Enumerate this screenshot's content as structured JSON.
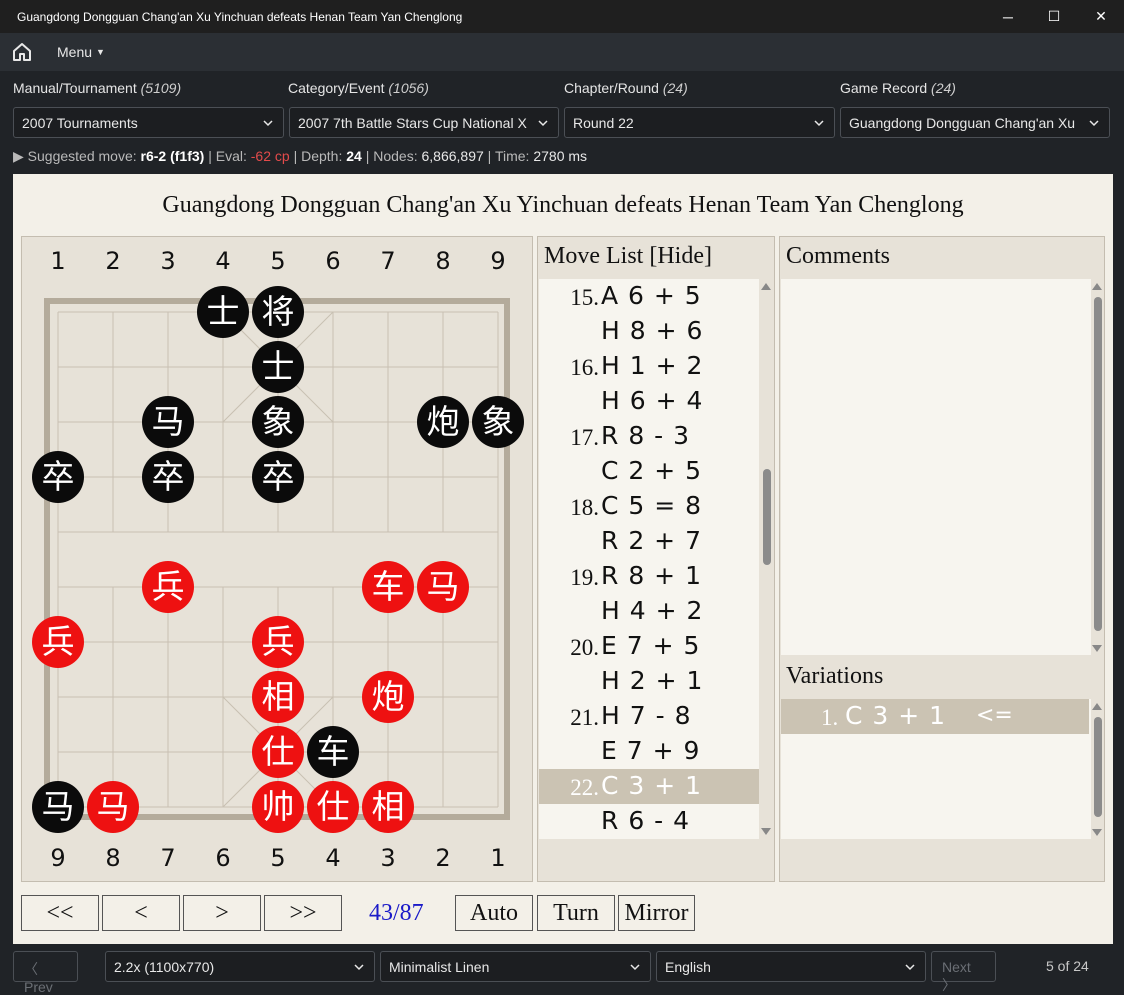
{
  "window": {
    "title": "Guangdong Dongguan Chang'an Xu Yinchuan defeats Henan Team Yan Chenglong",
    "minimize": "─",
    "maximize": "☐",
    "close": "✕"
  },
  "menubar": {
    "home_icon": "home-icon",
    "menu_label": "Menu"
  },
  "selectors": [
    {
      "label": "Manual/Tournament",
      "count": "(5109)",
      "value": "2007 Tournaments"
    },
    {
      "label": "Category/Event",
      "count": "(1056)",
      "value": "2007 7th Battle Stars Cup National X"
    },
    {
      "label": "Chapter/Round",
      "count": "(24)",
      "value": "Round 22"
    },
    {
      "label": "Game Record",
      "count": "(24)",
      "value": "Guangdong Dongguan Chang'an Xu"
    }
  ],
  "engine": {
    "prefix": "▶  Suggested move: ",
    "move": "r6-2",
    "move_code": "(f1f3)",
    "eval_label": "Eval:",
    "eval_value": "-62 cp",
    "depth_label": "Depth:",
    "depth_value": "24",
    "nodes_label": "Nodes:",
    "nodes_value": "6,866,897",
    "time_label": "Time:",
    "time_value": "2780 ms"
  },
  "game_title": "Guangdong Dongguan Chang'an Xu Yinchuan defeats Henan Team Yan Chenglong",
  "board": {
    "top_files": [
      "1",
      "2",
      "3",
      "4",
      "5",
      "6",
      "7",
      "8",
      "9"
    ],
    "bottom_files": [
      "9",
      "8",
      "7",
      "6",
      "5",
      "4",
      "3",
      "2",
      "1"
    ],
    "pieces": [
      {
        "char": "士",
        "side": "black",
        "file": 3,
        "rank": 0
      },
      {
        "char": "将",
        "side": "black",
        "file": 4,
        "rank": 0
      },
      {
        "char": "士",
        "side": "black",
        "file": 4,
        "rank": 1
      },
      {
        "char": "马",
        "side": "black",
        "file": 2,
        "rank": 2
      },
      {
        "char": "象",
        "side": "black",
        "file": 4,
        "rank": 2
      },
      {
        "char": "炮",
        "side": "black",
        "file": 7,
        "rank": 2
      },
      {
        "char": "象",
        "side": "black",
        "file": 8,
        "rank": 2
      },
      {
        "char": "卒",
        "side": "black",
        "file": 0,
        "rank": 3
      },
      {
        "char": "卒",
        "side": "black",
        "file": 2,
        "rank": 3
      },
      {
        "char": "卒",
        "side": "black",
        "file": 4,
        "rank": 3
      },
      {
        "char": "兵",
        "side": "red",
        "file": 2,
        "rank": 5
      },
      {
        "char": "车",
        "side": "red",
        "file": 6,
        "rank": 5
      },
      {
        "char": "马",
        "side": "red",
        "file": 7,
        "rank": 5
      },
      {
        "char": "兵",
        "side": "red",
        "file": 0,
        "rank": 6
      },
      {
        "char": "兵",
        "side": "red",
        "file": 4,
        "rank": 6
      },
      {
        "char": "相",
        "side": "red",
        "file": 4,
        "rank": 7
      },
      {
        "char": "炮",
        "side": "red",
        "file": 6,
        "rank": 7
      },
      {
        "char": "仕",
        "side": "red",
        "file": 4,
        "rank": 8
      },
      {
        "char": "车",
        "side": "black",
        "file": 5,
        "rank": 8
      },
      {
        "char": "马",
        "side": "black",
        "file": 0,
        "rank": 9
      },
      {
        "char": "马",
        "side": "red",
        "file": 1,
        "rank": 9
      },
      {
        "char": "帅",
        "side": "red",
        "file": 4,
        "rank": 9
      },
      {
        "char": "仕",
        "side": "red",
        "file": 5,
        "rank": 9
      },
      {
        "char": "相",
        "side": "red",
        "file": 6,
        "rank": 9
      }
    ]
  },
  "move_list": {
    "header": "Move List [Hide]",
    "rows": [
      {
        "num": "15.",
        "move": "A 6 + 5"
      },
      {
        "num": "",
        "move": "H 8 + 6"
      },
      {
        "num": "16.",
        "move": "H 1 + 2"
      },
      {
        "num": "",
        "move": "H 6 + 4"
      },
      {
        "num": "17.",
        "move": "R 8 - 3"
      },
      {
        "num": "",
        "move": "C 2 + 5"
      },
      {
        "num": "18.",
        "move": "C 5 = 8"
      },
      {
        "num": "",
        "move": "R 2 + 7"
      },
      {
        "num": "19.",
        "move": "R 8 + 1"
      },
      {
        "num": "",
        "move": "H 4 + 2"
      },
      {
        "num": "20.",
        "move": "E 7 + 5"
      },
      {
        "num": "",
        "move": "H 2 + 1"
      },
      {
        "num": "21.",
        "move": "H 7 - 8"
      },
      {
        "num": "",
        "move": "E 7 + 9"
      },
      {
        "num": "22.",
        "move": "C 3 + 1",
        "selected": true
      },
      {
        "num": "",
        "move": "R 6 - 4"
      }
    ]
  },
  "comments": {
    "header": "Comments"
  },
  "variations": {
    "header": "Variations",
    "items": [
      {
        "num": "1.",
        "move": "C 3 + 1",
        "marker": "<="
      }
    ]
  },
  "nav": {
    "first": "<<",
    "prev": "<",
    "next": ">",
    "last": ">>",
    "counter": "43/87",
    "auto": "Auto",
    "turn": "Turn",
    "mirror": "Mirror"
  },
  "footer": {
    "prev": "Prev",
    "scale": "2.2x (1100x770)",
    "theme": "Minimalist Linen",
    "language": "English",
    "next": "Next",
    "pager": "5 of 24"
  },
  "colors": {
    "red_piece": "#ee1111",
    "black_piece": "#0b0b0b",
    "panel_bg": "#e7e2d8",
    "selected_row": "#cbc3b3",
    "counter": "#1a1ac8"
  }
}
